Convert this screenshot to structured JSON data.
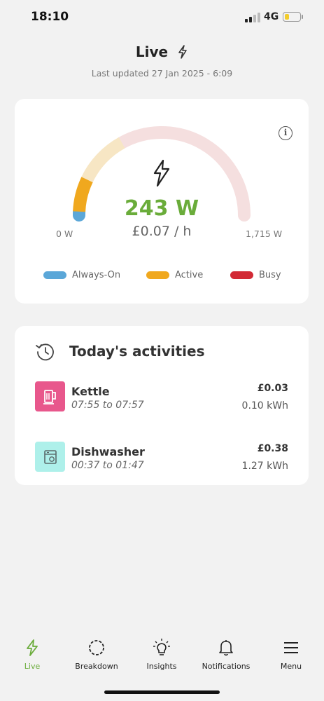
{
  "status_bar": {
    "time": "18:10",
    "network": "4G"
  },
  "header": {
    "title": "Live",
    "subtitle": "Last updated 27 Jan 2025 - 6:09"
  },
  "live": {
    "power": "243 W",
    "cost_rate": "£0.07 / h",
    "min_label": "0 W",
    "max_label": "1,715 W",
    "gauge_max_watts": 1715,
    "segments": {
      "always_on_watts": 24,
      "active_watts": 219
    },
    "colors": {
      "always_on": "#5ba7d8",
      "active": "#f0a81e",
      "busy": "#d22a35",
      "always_on_light": "#cde4f2",
      "active_light": "#f7e6c4",
      "busy_light": "#f5dfdf",
      "power_green": "#6aac3a"
    },
    "legend": [
      {
        "label": "Always-On",
        "color": "#5ba7d8"
      },
      {
        "label": "Active",
        "color": "#f0a81e"
      },
      {
        "label": "Busy",
        "color": "#d22a35"
      }
    ]
  },
  "activities": {
    "title": "Today's activities",
    "items": [
      {
        "name": "Kettle",
        "time": "07:55 to 07:57",
        "cost": "£0.03",
        "energy": "0.10 kWh",
        "icon": "kettle-icon",
        "icon_bg": "#e8578c"
      },
      {
        "name": "Dishwasher",
        "time": "00:37 to 01:47",
        "cost": "£0.38",
        "energy": "1.27 kWh",
        "icon": "dishwasher-icon",
        "icon_bg": "#aef0ea"
      }
    ]
  },
  "nav": {
    "items": [
      {
        "label": "Live",
        "icon": "bolt-icon",
        "active": true
      },
      {
        "label": "Breakdown",
        "icon": "dashed-circle-icon",
        "active": false
      },
      {
        "label": "Insights",
        "icon": "lightbulb-icon",
        "active": false
      },
      {
        "label": "Notifications",
        "icon": "bell-icon",
        "active": false
      },
      {
        "label": "Menu",
        "icon": "hamburger-menu-icon",
        "active": false
      }
    ]
  }
}
